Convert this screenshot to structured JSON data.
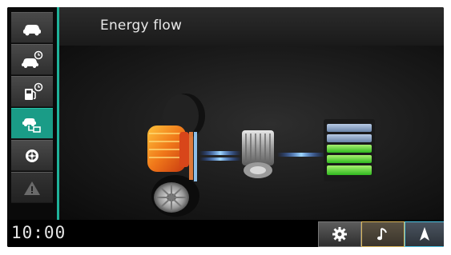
{
  "header": {
    "title": "Energy flow"
  },
  "clock": {
    "time": "10:00"
  },
  "sidebar": {
    "items": [
      {
        "icon": "car-icon",
        "active": false
      },
      {
        "icon": "car-trip-timer-icon",
        "active": false
      },
      {
        "icon": "fuel-timer-icon",
        "active": false
      },
      {
        "icon": "energy-flow-icon",
        "active": true
      },
      {
        "icon": "tire-icon",
        "active": false
      },
      {
        "icon": "warning-icon",
        "active": false
      }
    ]
  },
  "bottom_bar": {
    "buttons": [
      {
        "icon": "settings-gear-icon"
      },
      {
        "icon": "music-note-icon"
      },
      {
        "icon": "navigation-arrow-icon"
      }
    ]
  },
  "colors": {
    "accent": "#1fb29a",
    "engine": "#f07a1a",
    "battery_charged": "#4cd83a",
    "battery_empty": "#8fa6c4",
    "energy_beam": "#4aa8ff"
  },
  "energy_flow": {
    "battery_level_bars": 3,
    "battery_total_bars": 5
  }
}
